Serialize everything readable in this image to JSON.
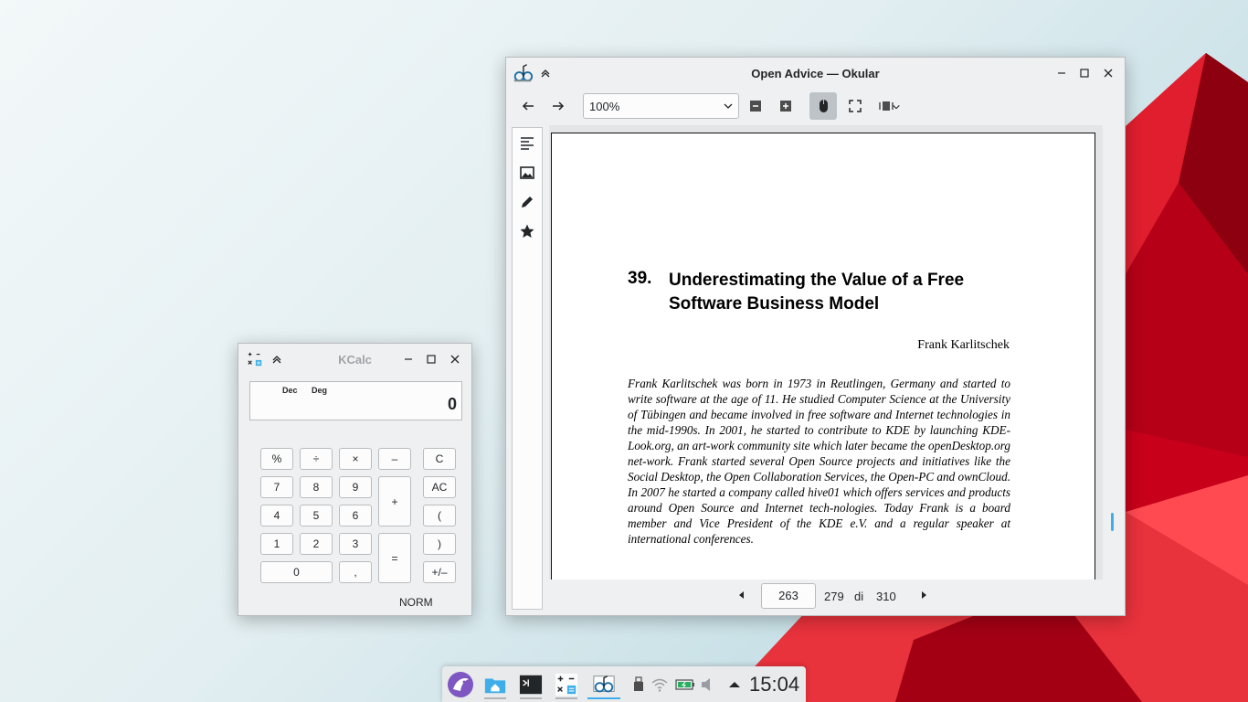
{
  "okular": {
    "title": "Open Advice — Okular",
    "zoom_value": "100%",
    "document": {
      "chapter_number": "39.",
      "chapter_title_line1": "Underestimating the Value of a Free",
      "chapter_title_line2": "Software Business Model",
      "author": "Frank Karlitschek",
      "bio": "Frank Karlitschek was born in 1973 in Reutlingen, Germany and started to write software at the age of 11. He studied Computer Science at the University of Tübingen and became involved in free software and Internet technologies in the mid-1990s. In 2001, he started to contribute to KDE by launching KDE-Look.org, an art-work community site which later became the openDesktop.org net-work. Frank started several Open Source projects and initiatives like the Social Desktop, the Open Collaboration Services, the Open-PC and ownCloud. In 2007 he started a company called hive01 which offers services and products around Open Source and Internet tech-nologies. Today Frank is a board member and Vice President of the KDE e.V. and a regular speaker at international conferences."
    },
    "pager": {
      "current_page": "263",
      "page_label": "279",
      "of_label": "di",
      "total_pages": "310"
    }
  },
  "kcalc": {
    "title": "KCalc",
    "indicator_base": "Dec",
    "indicator_angle": "Deg",
    "display_value": "0",
    "mode": "NORM",
    "buttons": {
      "percent": "%",
      "divide": "÷",
      "multiply": "×",
      "minus": "–",
      "clear": "C",
      "seven": "7",
      "eight": "8",
      "nine": "9",
      "plus": "+",
      "all_clear": "AC",
      "four": "4",
      "five": "5",
      "six": "6",
      "open_paren": "(",
      "one": "1",
      "two": "2",
      "three": "3",
      "equals": "=",
      "close_paren": ")",
      "zero": "0",
      "decimal": ",",
      "sign": "+/–"
    }
  },
  "taskbar": {
    "clock": "15:04"
  },
  "colors": {
    "accent": "#3daee9",
    "wallpaper_red": "#d3001b"
  }
}
